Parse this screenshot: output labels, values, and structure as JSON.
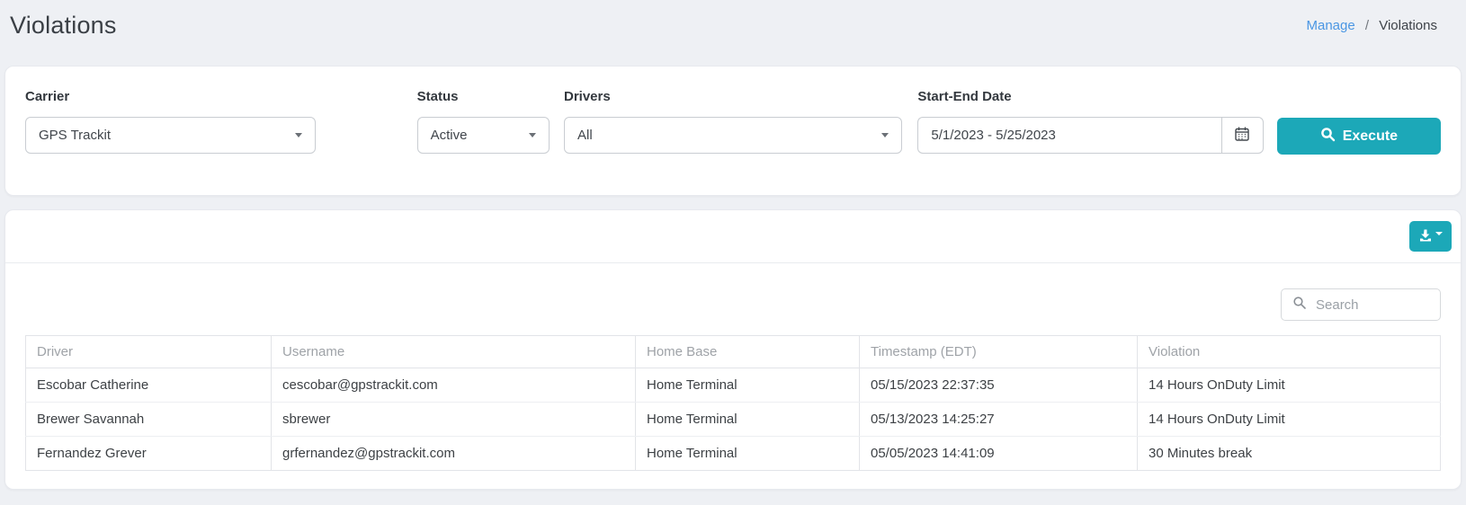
{
  "page": {
    "title": "Violations"
  },
  "breadcrumb": {
    "parent": "Manage",
    "separator": "/",
    "current": "Violations"
  },
  "filters": {
    "carrier": {
      "label": "Carrier",
      "value": "GPS Trackit"
    },
    "status": {
      "label": "Status",
      "value": "Active"
    },
    "drivers": {
      "label": "Drivers",
      "value": "All"
    },
    "date_range": {
      "label": "Start-End Date",
      "value": "5/1/2023 - 5/25/2023",
      "icon": "calendar-icon"
    },
    "execute": {
      "label": "Execute",
      "icon": "search-icon"
    }
  },
  "toolbar": {
    "export_button": {
      "icon": "download-icon",
      "caret": "caret-down-icon"
    }
  },
  "search": {
    "placeholder": "Search",
    "icon": "search-icon"
  },
  "table": {
    "columns": [
      "Driver",
      "Username",
      "Home Base",
      "Timestamp (EDT)",
      "Violation"
    ],
    "rows": [
      [
        "Escobar Catherine",
        "cescobar@gpstrackit.com",
        "Home Terminal",
        "05/15/2023 22:37:35",
        "14 Hours OnDuty Limit"
      ],
      [
        "Brewer Savannah",
        "sbrewer",
        "Home Terminal",
        "05/13/2023 14:25:27",
        "14 Hours OnDuty Limit"
      ],
      [
        "Fernandez Grever",
        "grfernandez@gpstrackit.com",
        "Home Terminal",
        "05/05/2023 14:41:09",
        "30 Minutes break"
      ]
    ]
  },
  "colors": {
    "accent_teal": "#1ca8b8",
    "link_blue": "#4a96e3",
    "page_background": "#eef0f4"
  }
}
